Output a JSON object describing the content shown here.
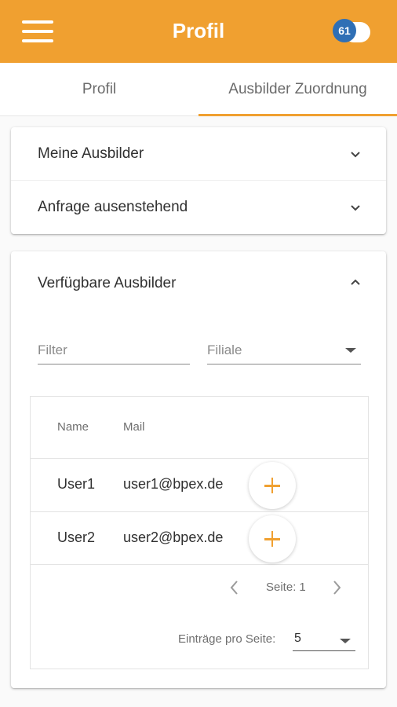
{
  "appbar": {
    "title": "Profil",
    "badge_count": "61"
  },
  "tabs": [
    {
      "label": "Profil",
      "active": false
    },
    {
      "label": "Ausbilder Zuordnung",
      "active": true
    }
  ],
  "panels": {
    "my_trainers": "Meine Ausbilder",
    "pending_requests": "Anfrage ausenstehend",
    "available_trainers": "Verfügbare Ausbilder"
  },
  "filters": {
    "filter_placeholder": "Filter",
    "branch_label": "Filiale"
  },
  "table": {
    "headers": {
      "name": "Name",
      "mail": "Mail"
    },
    "rows": [
      {
        "name": "User1",
        "mail": "user1@bpex.de"
      },
      {
        "name": "User2",
        "mail": "user2@bpex.de"
      }
    ],
    "pagination": {
      "page_label": "Seite:",
      "page_number": "1"
    },
    "per_page": {
      "label": "Einträge pro Seite:",
      "value": "5"
    }
  },
  "colors": {
    "accent": "#f0a030",
    "badge": "#2f6fb5"
  },
  "icons": [
    "menu-icon",
    "chevron-down-icon",
    "chevron-up-icon",
    "plus-icon",
    "chevron-left-icon",
    "chevron-right-icon",
    "dropdown-caret-icon"
  ]
}
